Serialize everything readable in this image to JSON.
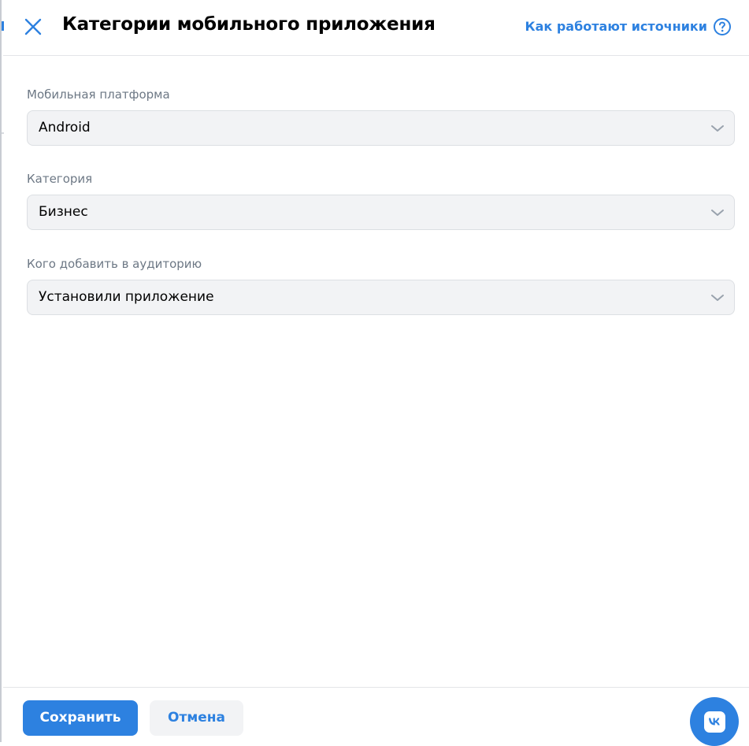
{
  "header": {
    "title": "Категории мобильного приложения",
    "help_link": "Как работают источники",
    "close_icon": "close-icon",
    "help_icon": "question-circle-icon"
  },
  "fields": [
    {
      "label": "Мобильная платформа",
      "value": "Android"
    },
    {
      "label": "Категория",
      "value": "Бизнес"
    },
    {
      "label": "Кого добавить в аудиторию",
      "value": "Установили приложение"
    }
  ],
  "footer": {
    "save_label": "Сохранить",
    "cancel_label": "Отмена"
  },
  "fab": {
    "icon": "vk-logo-icon"
  },
  "colors": {
    "accent": "#2d81e0",
    "field_bg": "#f2f3f5",
    "label": "#6d7885"
  }
}
